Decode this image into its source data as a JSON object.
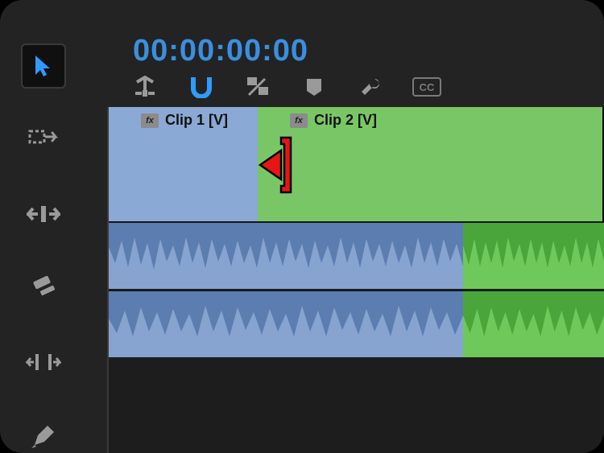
{
  "timecode": "00:00:00:00",
  "tool_rail": {
    "selection": "selection-tool",
    "items": [
      {
        "name": "selection-tool"
      },
      {
        "name": "track-select-forward-tool"
      },
      {
        "name": "ripple-edit-tool"
      },
      {
        "name": "razor-tool"
      },
      {
        "name": "slip-tool"
      },
      {
        "name": "pen-tool"
      }
    ]
  },
  "timeline_options": [
    {
      "name": "insert-overwrite-toggle",
      "active": false
    },
    {
      "name": "snap-toggle",
      "active": true
    },
    {
      "name": "linked-selection-toggle",
      "active": false
    },
    {
      "name": "add-marker",
      "active": false
    },
    {
      "name": "settings",
      "active": false
    },
    {
      "name": "captions-toggle",
      "active": false
    }
  ],
  "video_track": {
    "clips": [
      {
        "label": "Clip 1 [V]",
        "color": "blue",
        "fx": "fx"
      },
      {
        "label": "Clip 2 [V]",
        "color": "green",
        "fx": "fx"
      }
    ]
  },
  "audio_tracks": [
    {
      "clips": [
        {
          "color": "blue"
        },
        {
          "color": "green"
        }
      ]
    },
    {
      "clips": [
        {
          "color": "blue"
        },
        {
          "color": "green"
        }
      ]
    }
  ],
  "edit_cursor": {
    "type": "ripple-trim-left"
  },
  "colors": {
    "blue_clip": "#8aa9d4",
    "green_clip": "#79c666",
    "blue_wave": "#5b7db0",
    "green_wave": "#4aa63a",
    "timecode": "#3a8fe0",
    "cursor": "#e11"
  }
}
